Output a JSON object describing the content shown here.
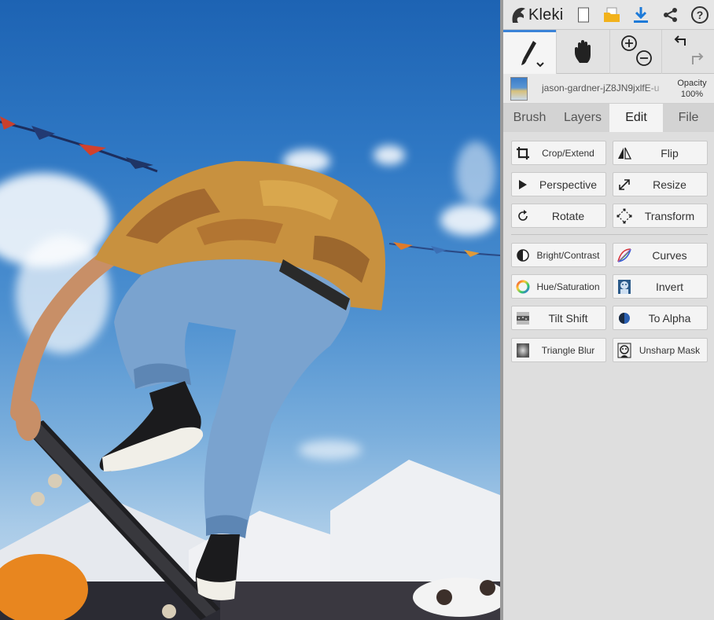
{
  "app": {
    "name": "Kleki",
    "top_icons": [
      "new-image-icon",
      "open-folder-icon",
      "download-icon",
      "share-icon",
      "help-icon"
    ]
  },
  "tools": [
    "brush-icon",
    "hand-icon",
    "zoom-icon",
    "undo-redo-icon"
  ],
  "layer": {
    "name": "jason-gardner-jZ8JN9jxlfE-u",
    "opacity_label": "Opacity",
    "opacity_value": "100%"
  },
  "tabs": [
    {
      "label": "Brush",
      "active": false
    },
    {
      "label": "Layers",
      "active": false
    },
    {
      "label": "Edit",
      "active": true
    },
    {
      "label": "File",
      "active": false
    }
  ],
  "edit_buttons": [
    {
      "label": "Crop/Extend",
      "icon": "crop-icon"
    },
    {
      "label": "Flip",
      "icon": "flip-icon"
    },
    {
      "label": "Perspective",
      "icon": "perspective-icon"
    },
    {
      "label": "Resize",
      "icon": "resize-icon"
    },
    {
      "label": "Rotate",
      "icon": "rotate-icon"
    },
    {
      "label": "Transform",
      "icon": "transform-icon"
    },
    {
      "label": "Bright/Contrast",
      "icon": "bright-contrast-icon"
    },
    {
      "label": "Curves",
      "icon": "curves-icon"
    },
    {
      "label": "Hue/Saturation",
      "icon": "hue-saturation-icon"
    },
    {
      "label": "Invert",
      "icon": "invert-icon"
    },
    {
      "label": "Tilt Shift",
      "icon": "tilt-shift-icon"
    },
    {
      "label": "To Alpha",
      "icon": "to-alpha-icon"
    },
    {
      "label": "Triangle Blur",
      "icon": "triangle-blur-icon"
    },
    {
      "label": "Unsharp Mask",
      "icon": "unsharp-mask-icon"
    }
  ],
  "colors": {
    "accent": "#3a83d8",
    "panel_bg": "#d6d6d6",
    "button_bg": "#f4f4f4"
  }
}
